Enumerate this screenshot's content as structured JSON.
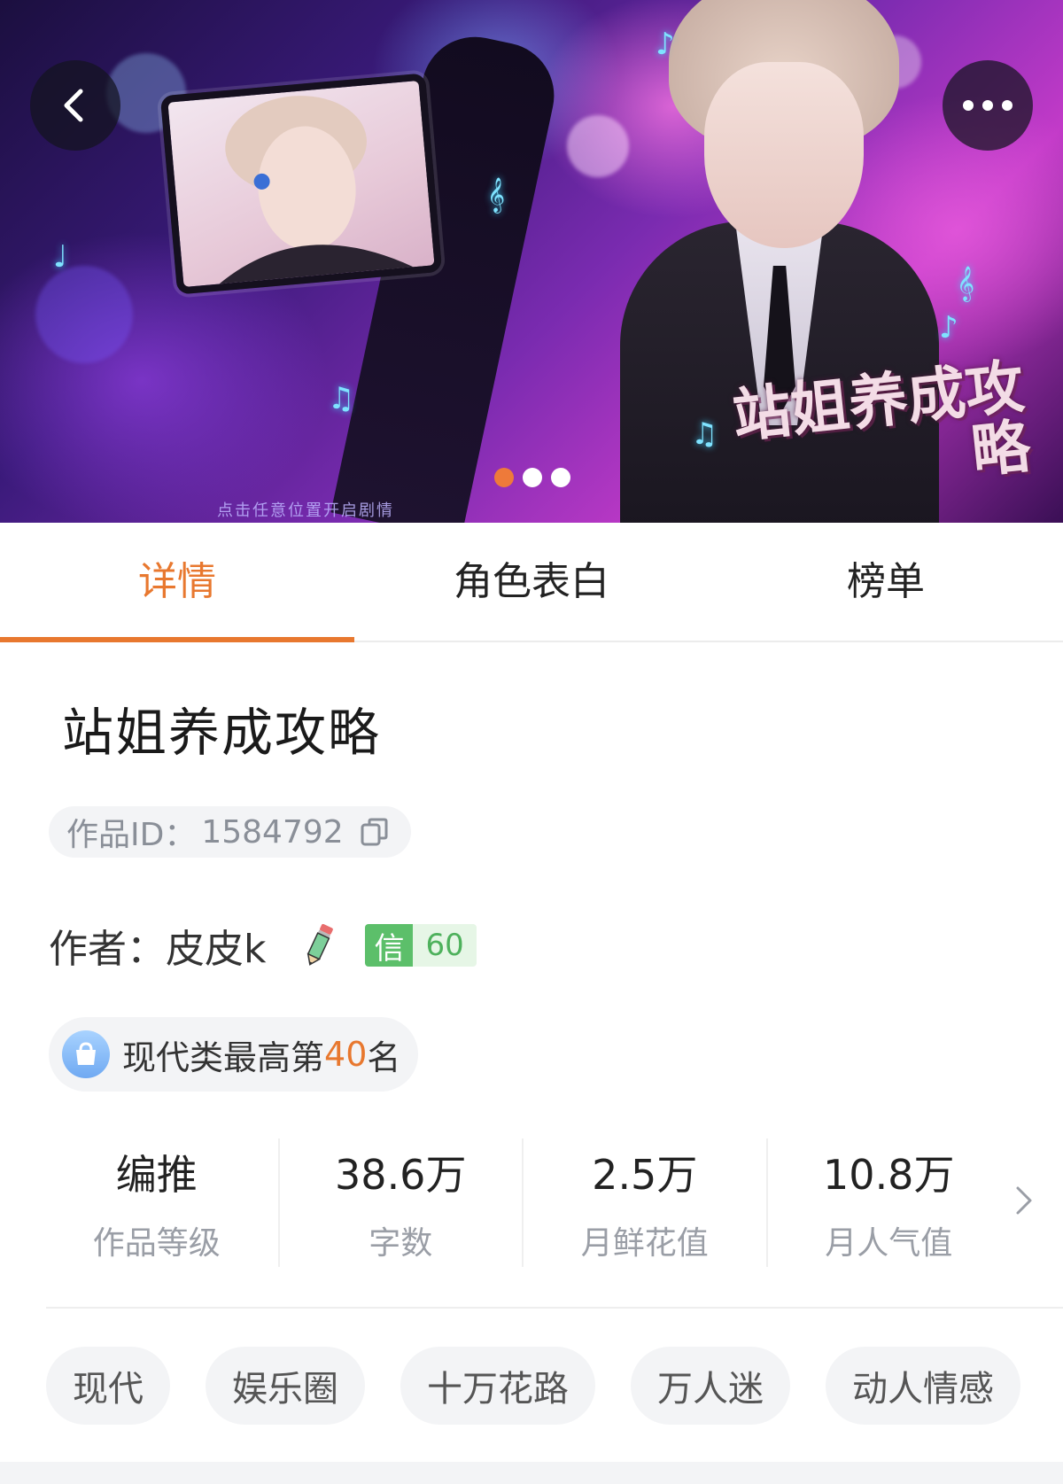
{
  "banner": {
    "hint_text": "点击任意位置开启剧情",
    "logo_text": "站姐养成攻略",
    "carousel_total": 3,
    "carousel_active": 1
  },
  "tabs": [
    {
      "label": "详情",
      "active": true
    },
    {
      "label": "角色表白",
      "active": false
    },
    {
      "label": "榜单",
      "active": false
    }
  ],
  "work": {
    "title": "站姐养成攻略",
    "id_label": "作品ID：",
    "id_value": "1584792"
  },
  "author": {
    "label": "作者：",
    "name": "皮皮k",
    "credit_label": "信",
    "credit_value": "60"
  },
  "rank": {
    "prefix": "现代类最高第",
    "number": "40",
    "suffix": "名"
  },
  "stats": [
    {
      "value": "编推",
      "label": "作品等级"
    },
    {
      "value": "38.6万",
      "label": "字数"
    },
    {
      "value": "2.5万",
      "label": "月鲜花值"
    },
    {
      "value": "10.8万",
      "label": "月人气值"
    }
  ],
  "tags": [
    "现代",
    "娱乐圈",
    "十万花路",
    "万人迷",
    "动人情感"
  ],
  "colors": {
    "accent": "#e8782f",
    "credit_green": "#5cbf6a",
    "chip_bg": "#f3f4f6"
  }
}
